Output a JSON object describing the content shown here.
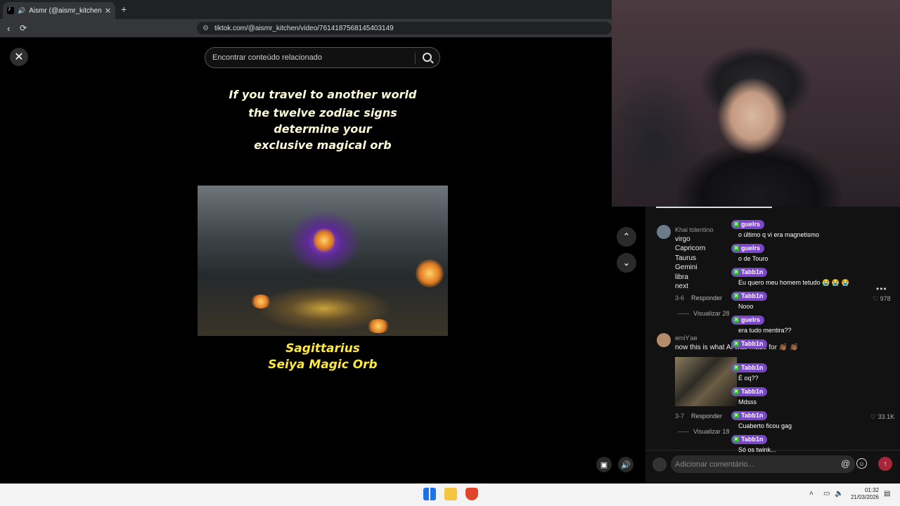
{
  "browser": {
    "tab_title": "Aismr (@aismr_kitchen) | Tik",
    "new_tab": "+",
    "tab_close": "✕",
    "back": "‹",
    "reload": "⟳",
    "url": "tiktok.com/@aismr_kitchen/video/7614187568145403149"
  },
  "page": {
    "close": "✕",
    "search_placeholder": "Encontrar conteúdo relacionado"
  },
  "video": {
    "headline": [
      "If you travel to another world",
      "the twelve zodiac signs",
      "determine your",
      "exclusive magical orb"
    ],
    "caption": [
      "Sagittarius",
      "Seiya Magic Orb"
    ]
  },
  "controls": {
    "prev": "⌃",
    "next": "⌄"
  },
  "comments": [
    {
      "user": "Khai tolentino",
      "lines": [
        "virgo",
        "Capricorn",
        "Taurus",
        "Gemini",
        "libra",
        "next"
      ],
      "date": "3-6",
      "reply": "Responder",
      "likes": "978",
      "view_more": "Visualizar 28"
    },
    {
      "user": "ɵmiƳaɵ",
      "lines": [
        "now this is what AI was made for 👏🏾 👏🏾"
      ],
      "date": "3-7",
      "reply": "Responder",
      "likes": "33.1K",
      "view_more": "Visualizar 18"
    }
  ],
  "comment_input": {
    "placeholder": "Adicionar comentário...",
    "at": "@",
    "emoji": "☺",
    "send": "↑"
  },
  "chat": [
    {
      "user": "guelrs",
      "text": "o último q vi era magnetismo"
    },
    {
      "user": "guelrs",
      "text": "o de Touro"
    },
    {
      "user": "Tabb1n",
      "text": "Eu quero meu homem tetudo 😭 😭 😭"
    },
    {
      "user": "Tabb1n",
      "text": "Nooo"
    },
    {
      "user": "guelrs",
      "text": "era tudo mentira??"
    },
    {
      "user": "Tabb1n",
      "text": ""
    },
    {
      "user": "Tabb1n",
      "text": "É oq??"
    },
    {
      "user": "Tabb1n",
      "text": "Mdsss"
    },
    {
      "user": "Tabb1n",
      "text": "Cuaberto ficou gag"
    },
    {
      "user": "Tabb1n",
      "text": "Só os twink..."
    }
  ],
  "taskbar": {
    "time": "01:32",
    "date": "21/03/2026",
    "colors": {
      "windows": "#1a73e8",
      "explorer": "#f5c542",
      "brave": "#e0452a"
    }
  }
}
